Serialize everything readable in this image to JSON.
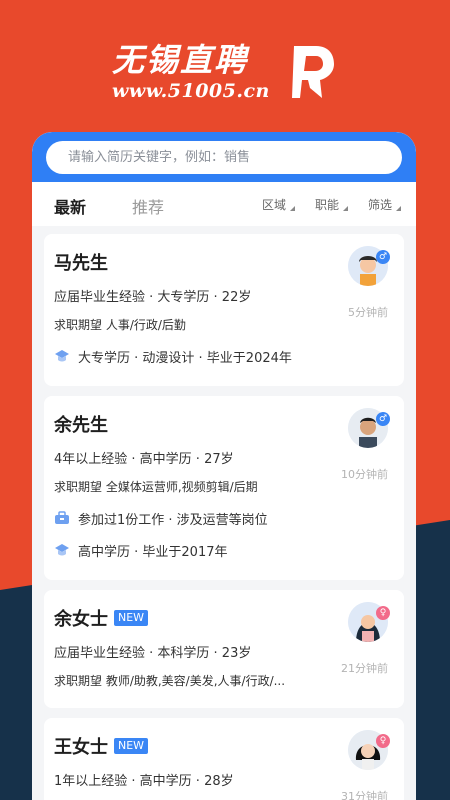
{
  "brand": {
    "title": "无锡直聘",
    "url": "www.51005.cn"
  },
  "search": {
    "placeholder": "请输入简历关键字，例如：销售"
  },
  "tabs": {
    "latest": "最新",
    "recommend": "推荐"
  },
  "filters": {
    "region": "区域",
    "function": "职能",
    "screen": "筛选"
  },
  "colors": {
    "brand_red": "#e8492c",
    "navy": "#16314a",
    "accent_blue": "#2f7ff5"
  },
  "resumes": [
    {
      "name": "马先生",
      "badge": "",
      "meta": "应届毕业生经验 · 大专学历 · 22岁",
      "expect": "求职期望 人事/行政/后勤",
      "lines": [
        {
          "icon": "graduation-cap-icon",
          "text": "大专学历 · 动漫设计 · 毕业于2024年"
        }
      ],
      "gender": "male",
      "time": "5分钟前"
    },
    {
      "name": "余先生",
      "badge": "",
      "meta": "4年以上经验 · 高中学历 · 27岁",
      "expect": "求职期望 全媒体运营师,视频剪辑/后期",
      "lines": [
        {
          "icon": "briefcase-icon",
          "text": "参加过1份工作 · 涉及运营等岗位"
        },
        {
          "icon": "graduation-cap-icon",
          "text": "高中学历 · 毕业于2017年"
        }
      ],
      "gender": "male",
      "time": "10分钟前"
    },
    {
      "name": "余女士",
      "badge": "NEW",
      "meta": "应届毕业生经验 · 本科学历 · 23岁",
      "expect": "求职期望 教师/助教,美容/美发,人事/行政/...",
      "lines": [],
      "gender": "female",
      "time": "21分钟前"
    },
    {
      "name": "王女士",
      "badge": "NEW",
      "meta": "1年以上经验 · 高中学历 · 28岁",
      "expect": "",
      "lines": [],
      "gender": "female",
      "time": "31分钟前"
    }
  ]
}
